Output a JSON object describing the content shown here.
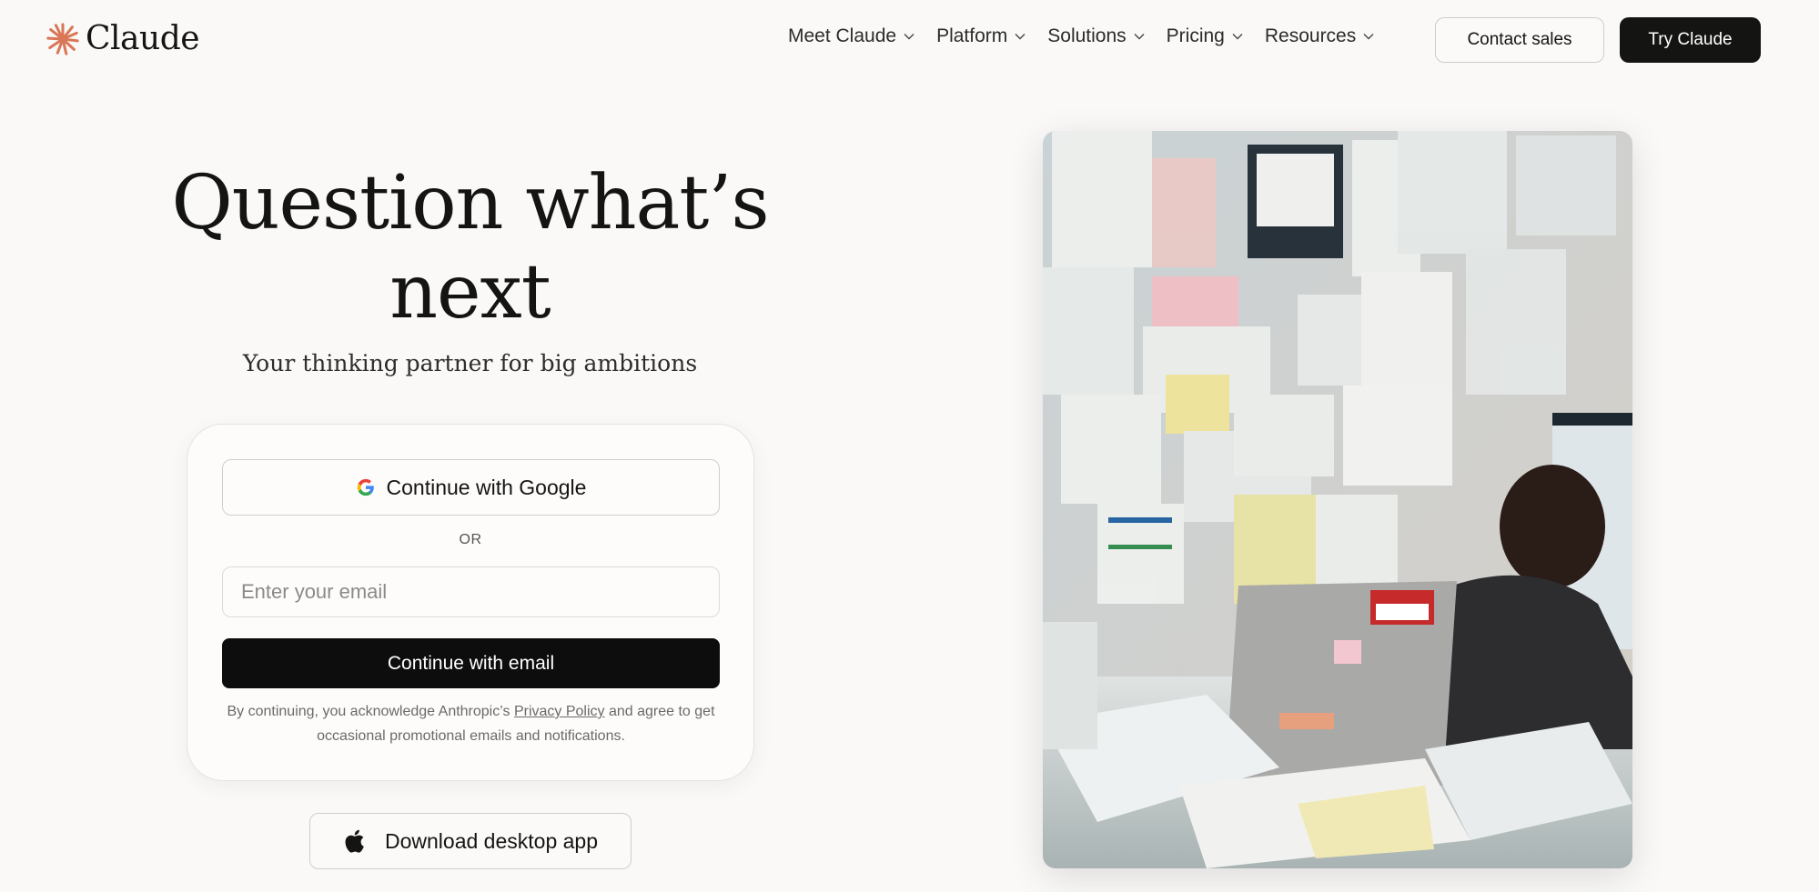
{
  "header": {
    "logo_text": "Claude",
    "nav": [
      {
        "label": "Meet Claude"
      },
      {
        "label": "Platform"
      },
      {
        "label": "Solutions"
      },
      {
        "label": "Pricing"
      },
      {
        "label": "Resources"
      }
    ],
    "contact_sales_label": "Contact sales",
    "try_label": "Try Claude"
  },
  "hero": {
    "headline_line1": "Question what’s",
    "headline_line2": "next",
    "subheadline": "Your thinking partner for big ambitions"
  },
  "signup": {
    "google_label": "Continue with Google",
    "or_label": "OR",
    "email_placeholder": "Enter your email",
    "email_value": "",
    "continue_email_label": "Continue with email",
    "disclaimer_before": "By continuing, you acknowledge Anthropic’s ",
    "privacy_link": "Privacy Policy",
    "disclaimer_after": " and agree to get occasional promotional emails and notifications."
  },
  "download": {
    "label": "Download desktop app",
    "icon": "apple-icon"
  },
  "colors": {
    "background": "#faf9f7",
    "brand_accent": "#d97757",
    "primary_button": "#141413",
    "text": "#141413"
  }
}
